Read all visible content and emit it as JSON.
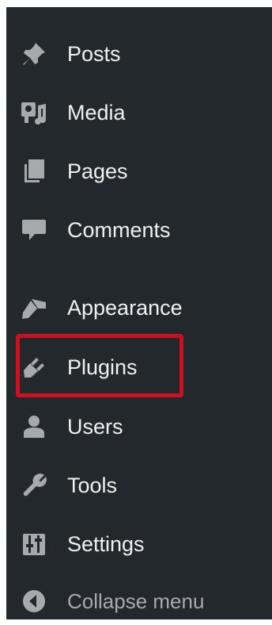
{
  "menu": {
    "items": [
      {
        "id": "posts",
        "label": "Posts",
        "icon": "pin-icon"
      },
      {
        "id": "media",
        "label": "Media",
        "icon": "media-icon"
      },
      {
        "id": "pages",
        "label": "Pages",
        "icon": "pages-icon"
      },
      {
        "id": "comments",
        "label": "Comments",
        "icon": "comment-icon"
      },
      {
        "id": "appearance",
        "label": "Appearance",
        "icon": "paintbrush-icon"
      },
      {
        "id": "plugins",
        "label": "Plugins",
        "icon": "plug-icon",
        "highlighted": true
      },
      {
        "id": "users",
        "label": "Users",
        "icon": "user-icon"
      },
      {
        "id": "tools",
        "label": "Tools",
        "icon": "wrench-icon"
      },
      {
        "id": "settings",
        "label": "Settings",
        "icon": "sliders-icon"
      }
    ],
    "collapse": {
      "label": "Collapse menu",
      "icon": "collapse-arrow-icon"
    }
  },
  "colors": {
    "sidebar_bg": "#23282d",
    "text": "#f0f0f1",
    "icon": "#a7aaad",
    "muted_text": "#a7aaad",
    "highlight_border": "#cc1020"
  }
}
